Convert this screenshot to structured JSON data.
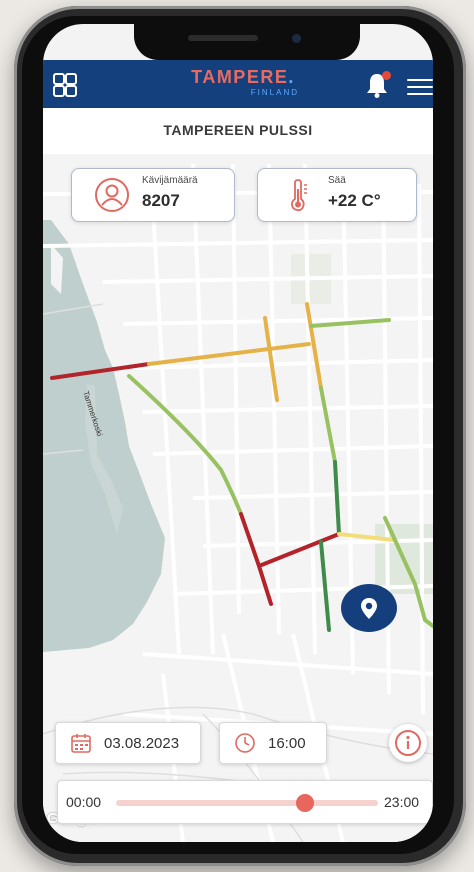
{
  "header": {
    "logo_main": "TAMPERE",
    "logo_dot": ".",
    "logo_sub": "FINLAND",
    "notification_badge": true
  },
  "page_title": "TAMPEREEN PULSSI",
  "stats": {
    "visitors_label": "Kävijämäärä",
    "visitors_value": "8207",
    "weather_label": "Sää",
    "weather_value": "+22 C°"
  },
  "map": {
    "place_label": "Tammerkoski",
    "attribution": "Google",
    "traffic_colors": {
      "red": "#b3232a",
      "orange": "#e5b248",
      "yellow": "#f2dd78",
      "light_green": "#98c261",
      "dark_green": "#3f8b4c"
    }
  },
  "controls": {
    "date": "03.08.2023",
    "time": "16:00",
    "slider_start": "00:00",
    "slider_end": "23:00",
    "slider_position": 0.72
  },
  "icons": {
    "menu_grid": "grid-icon",
    "notifications": "bell-icon",
    "hamburger": "menu-icon",
    "visitors": "user-icon",
    "weather": "thermometer-icon",
    "calendar": "calendar-icon",
    "clock": "clock-icon",
    "info": "info-icon",
    "location": "location-pin-icon"
  }
}
